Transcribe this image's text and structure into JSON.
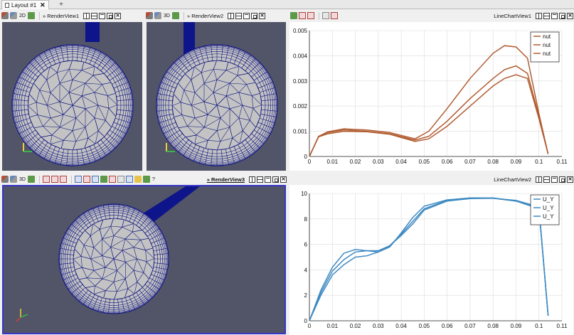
{
  "layout_tab": {
    "label": "Layout #1",
    "close": "✕",
    "add": "+"
  },
  "views": {
    "render1": {
      "label": "RenderView1",
      "dim": "2D"
    },
    "render2": {
      "label": "RenderView2",
      "dim": "3D"
    },
    "chart1": {
      "label": "LineChartView1"
    },
    "render3": {
      "label": "RenderView3",
      "dim": "3D",
      "query": "?"
    },
    "chart2": {
      "label": "LineChartView2"
    }
  },
  "window_buttons": {
    "close": "✕"
  },
  "colors": {
    "mesh_bg": "#525468",
    "mesh_face": "#c3c3c3",
    "mesh_edge": "#0d1280",
    "nut_series": "#b15c31",
    "uy_series": "#3e8ac2",
    "active_border": "#3636c8"
  },
  "chart_data": [
    {
      "type": "line",
      "view": "LineChartView1",
      "xlim": [
        0,
        0.11
      ],
      "ylim": [
        0,
        0.005
      ],
      "xticks": [
        "0",
        "0.01",
        "0.02",
        "0.03",
        "0.04",
        "0.05",
        "0.06",
        "0.07",
        "0.08",
        "0.09",
        "0.1",
        "0.11"
      ],
      "yticks": [
        "0",
        "0.001",
        "0.002",
        "0.003",
        "0.004",
        "0.005"
      ],
      "legend_position": "top-right",
      "series": [
        {
          "name": "nut",
          "x": [
            0,
            0.004,
            0.008,
            0.015,
            0.025,
            0.035,
            0.046,
            0.052,
            0.06,
            0.07,
            0.08,
            0.085,
            0.09,
            0.095,
            0.1,
            0.104
          ],
          "y": [
            0,
            0.0008,
            0.00098,
            0.0011,
            0.00105,
            0.00095,
            0.0007,
            0.001,
            0.0019,
            0.0031,
            0.0041,
            0.0044,
            0.00435,
            0.0039,
            0.0017,
            0.0001
          ]
        },
        {
          "name": "nut",
          "x": [
            0,
            0.004,
            0.008,
            0.015,
            0.025,
            0.035,
            0.046,
            0.052,
            0.06,
            0.07,
            0.08,
            0.085,
            0.09,
            0.095,
            0.1,
            0.104
          ],
          "y": [
            0,
            0.0008,
            0.00095,
            0.00105,
            0.001,
            0.0009,
            0.00065,
            0.0008,
            0.0014,
            0.0023,
            0.0031,
            0.00345,
            0.0036,
            0.0033,
            0.0016,
            0.0001
          ]
        },
        {
          "name": "nut",
          "x": [
            0,
            0.004,
            0.008,
            0.015,
            0.025,
            0.035,
            0.046,
            0.052,
            0.06,
            0.07,
            0.08,
            0.085,
            0.09,
            0.095,
            0.1,
            0.104
          ],
          "y": [
            0,
            0.00078,
            0.0009,
            0.001,
            0.00098,
            0.00088,
            0.0006,
            0.0007,
            0.0012,
            0.002,
            0.0028,
            0.0031,
            0.00325,
            0.0031,
            0.0015,
            0.0001
          ]
        }
      ]
    },
    {
      "type": "line",
      "view": "LineChartView2",
      "xlim": [
        0,
        0.11
      ],
      "ylim": [
        0,
        10
      ],
      "xticks": [
        "0",
        "0.01",
        "0.02",
        "0.03",
        "0.04",
        "0.05",
        "0.06",
        "0.07",
        "0.08",
        "0.09",
        "0.1",
        "0.11"
      ],
      "yticks": [
        "0",
        "2",
        "4",
        "6",
        "8",
        "10"
      ],
      "legend_position": "top-right",
      "series": [
        {
          "name": "U_Y",
          "x": [
            0,
            0.005,
            0.01,
            0.015,
            0.02,
            0.025,
            0.03,
            0.035,
            0.04,
            0.045,
            0.05,
            0.06,
            0.07,
            0.08,
            0.09,
            0.1,
            0.104
          ],
          "y": [
            0,
            2.4,
            4.2,
            5.3,
            5.6,
            5.5,
            5.4,
            5.8,
            6.9,
            8.1,
            9.0,
            9.5,
            9.65,
            9.65,
            9.4,
            8.8,
            0.4
          ]
        },
        {
          "name": "U_Y",
          "x": [
            0,
            0.005,
            0.01,
            0.015,
            0.02,
            0.025,
            0.03,
            0.035,
            0.04,
            0.045,
            0.05,
            0.06,
            0.07,
            0.08,
            0.09,
            0.1,
            0.104
          ],
          "y": [
            0,
            2.2,
            3.9,
            4.8,
            5.4,
            5.5,
            5.5,
            5.9,
            6.8,
            7.8,
            8.8,
            9.45,
            9.62,
            9.62,
            9.4,
            8.9,
            0.4
          ]
        },
        {
          "name": "U_Y",
          "x": [
            0,
            0.005,
            0.01,
            0.015,
            0.02,
            0.025,
            0.03,
            0.035,
            0.04,
            0.045,
            0.05,
            0.06,
            0.07,
            0.08,
            0.09,
            0.1,
            0.104
          ],
          "y": [
            0,
            2.0,
            3.6,
            4.4,
            5.0,
            5.1,
            5.4,
            5.9,
            6.7,
            7.6,
            8.7,
            9.4,
            9.6,
            9.62,
            9.45,
            8.95,
            0.4
          ]
        }
      ]
    }
  ]
}
